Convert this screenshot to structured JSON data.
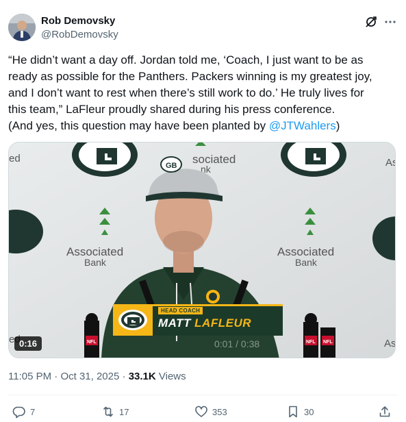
{
  "author": {
    "display_name": "Rob Demovsky",
    "handle": "@RobDemovsky"
  },
  "tweet": {
    "lines": [
      "“He didn’t want a day off. Jordan told me, ‘Coach, I just want to be as",
      "ready as possible for the Panthers. Packers winning is my greatest joy,",
      "and I don’t want to rest when there’s still work to do.’ He truly lives for",
      "this team,” LaFleur proudly shared during his press conference."
    ],
    "last_line_prefix": "(And yes, this question may have been planted by ",
    "mention": "@JTWahlers",
    "last_line_suffix": ")"
  },
  "video": {
    "duration_badge": "0:16",
    "lower_third_role": "HEAD COACH",
    "lower_third_first": "MATT ",
    "lower_third_last": "LAFLEUR",
    "ghost_time": "0:01 / 0:38",
    "backdrop_text_left": "Associated",
    "backdrop_text_left_sub": "Bank",
    "backdrop_text_right": "Associated",
    "backdrop_text_right_sub": "Bank",
    "backdrop_top_text": "sociated",
    "backdrop_top_sub": "nk",
    "edge_left_top": "ed",
    "edge_left_bottom": "ed",
    "edge_right_top": "As",
    "edge_right_bottom": "As",
    "hat_logo": "GB",
    "mic_brand": "NFL"
  },
  "meta": {
    "time": "11:05 PM",
    "separator": " · ",
    "date": "Oct 31, 2025",
    "views_count": "33.1K",
    "views_label": " Views"
  },
  "actions": {
    "replies": "7",
    "reposts": "17",
    "likes": "353",
    "bookmarks": "30"
  },
  "colors": {
    "accent": "#1d9bf0",
    "packers_green": "#203731",
    "packers_gold": "#ffb612"
  }
}
